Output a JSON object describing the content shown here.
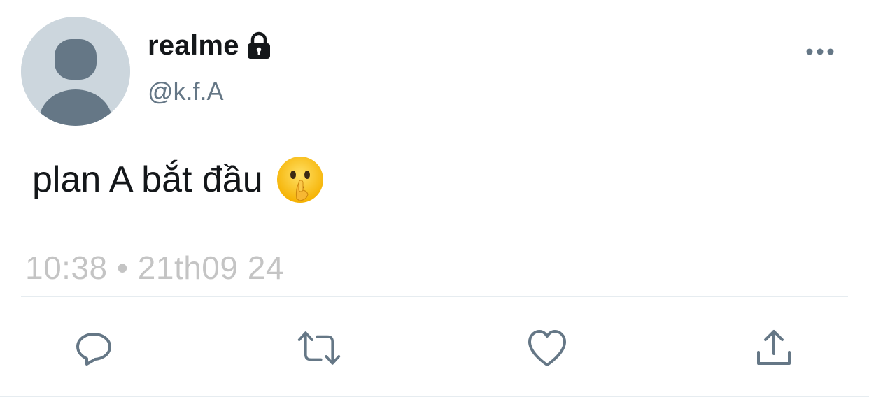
{
  "author": {
    "display_name": "realme",
    "handle": "@k.f.A",
    "protected": true
  },
  "tweet": {
    "text": "plan A bắt đầu",
    "emoji": "shushing-face",
    "timestamp": "10:38 • 21th09 24"
  },
  "actions": {
    "reply": "reply-icon",
    "retweet": "retweet-icon",
    "like": "heart-icon",
    "share": "share-icon"
  },
  "colors": {
    "text_primary": "#14171a",
    "text_secondary": "#657786",
    "timestamp": "#c4c4c4",
    "icon": "#657786",
    "avatar_bg": "#ccd6dd",
    "avatar_fg": "#657786"
  }
}
